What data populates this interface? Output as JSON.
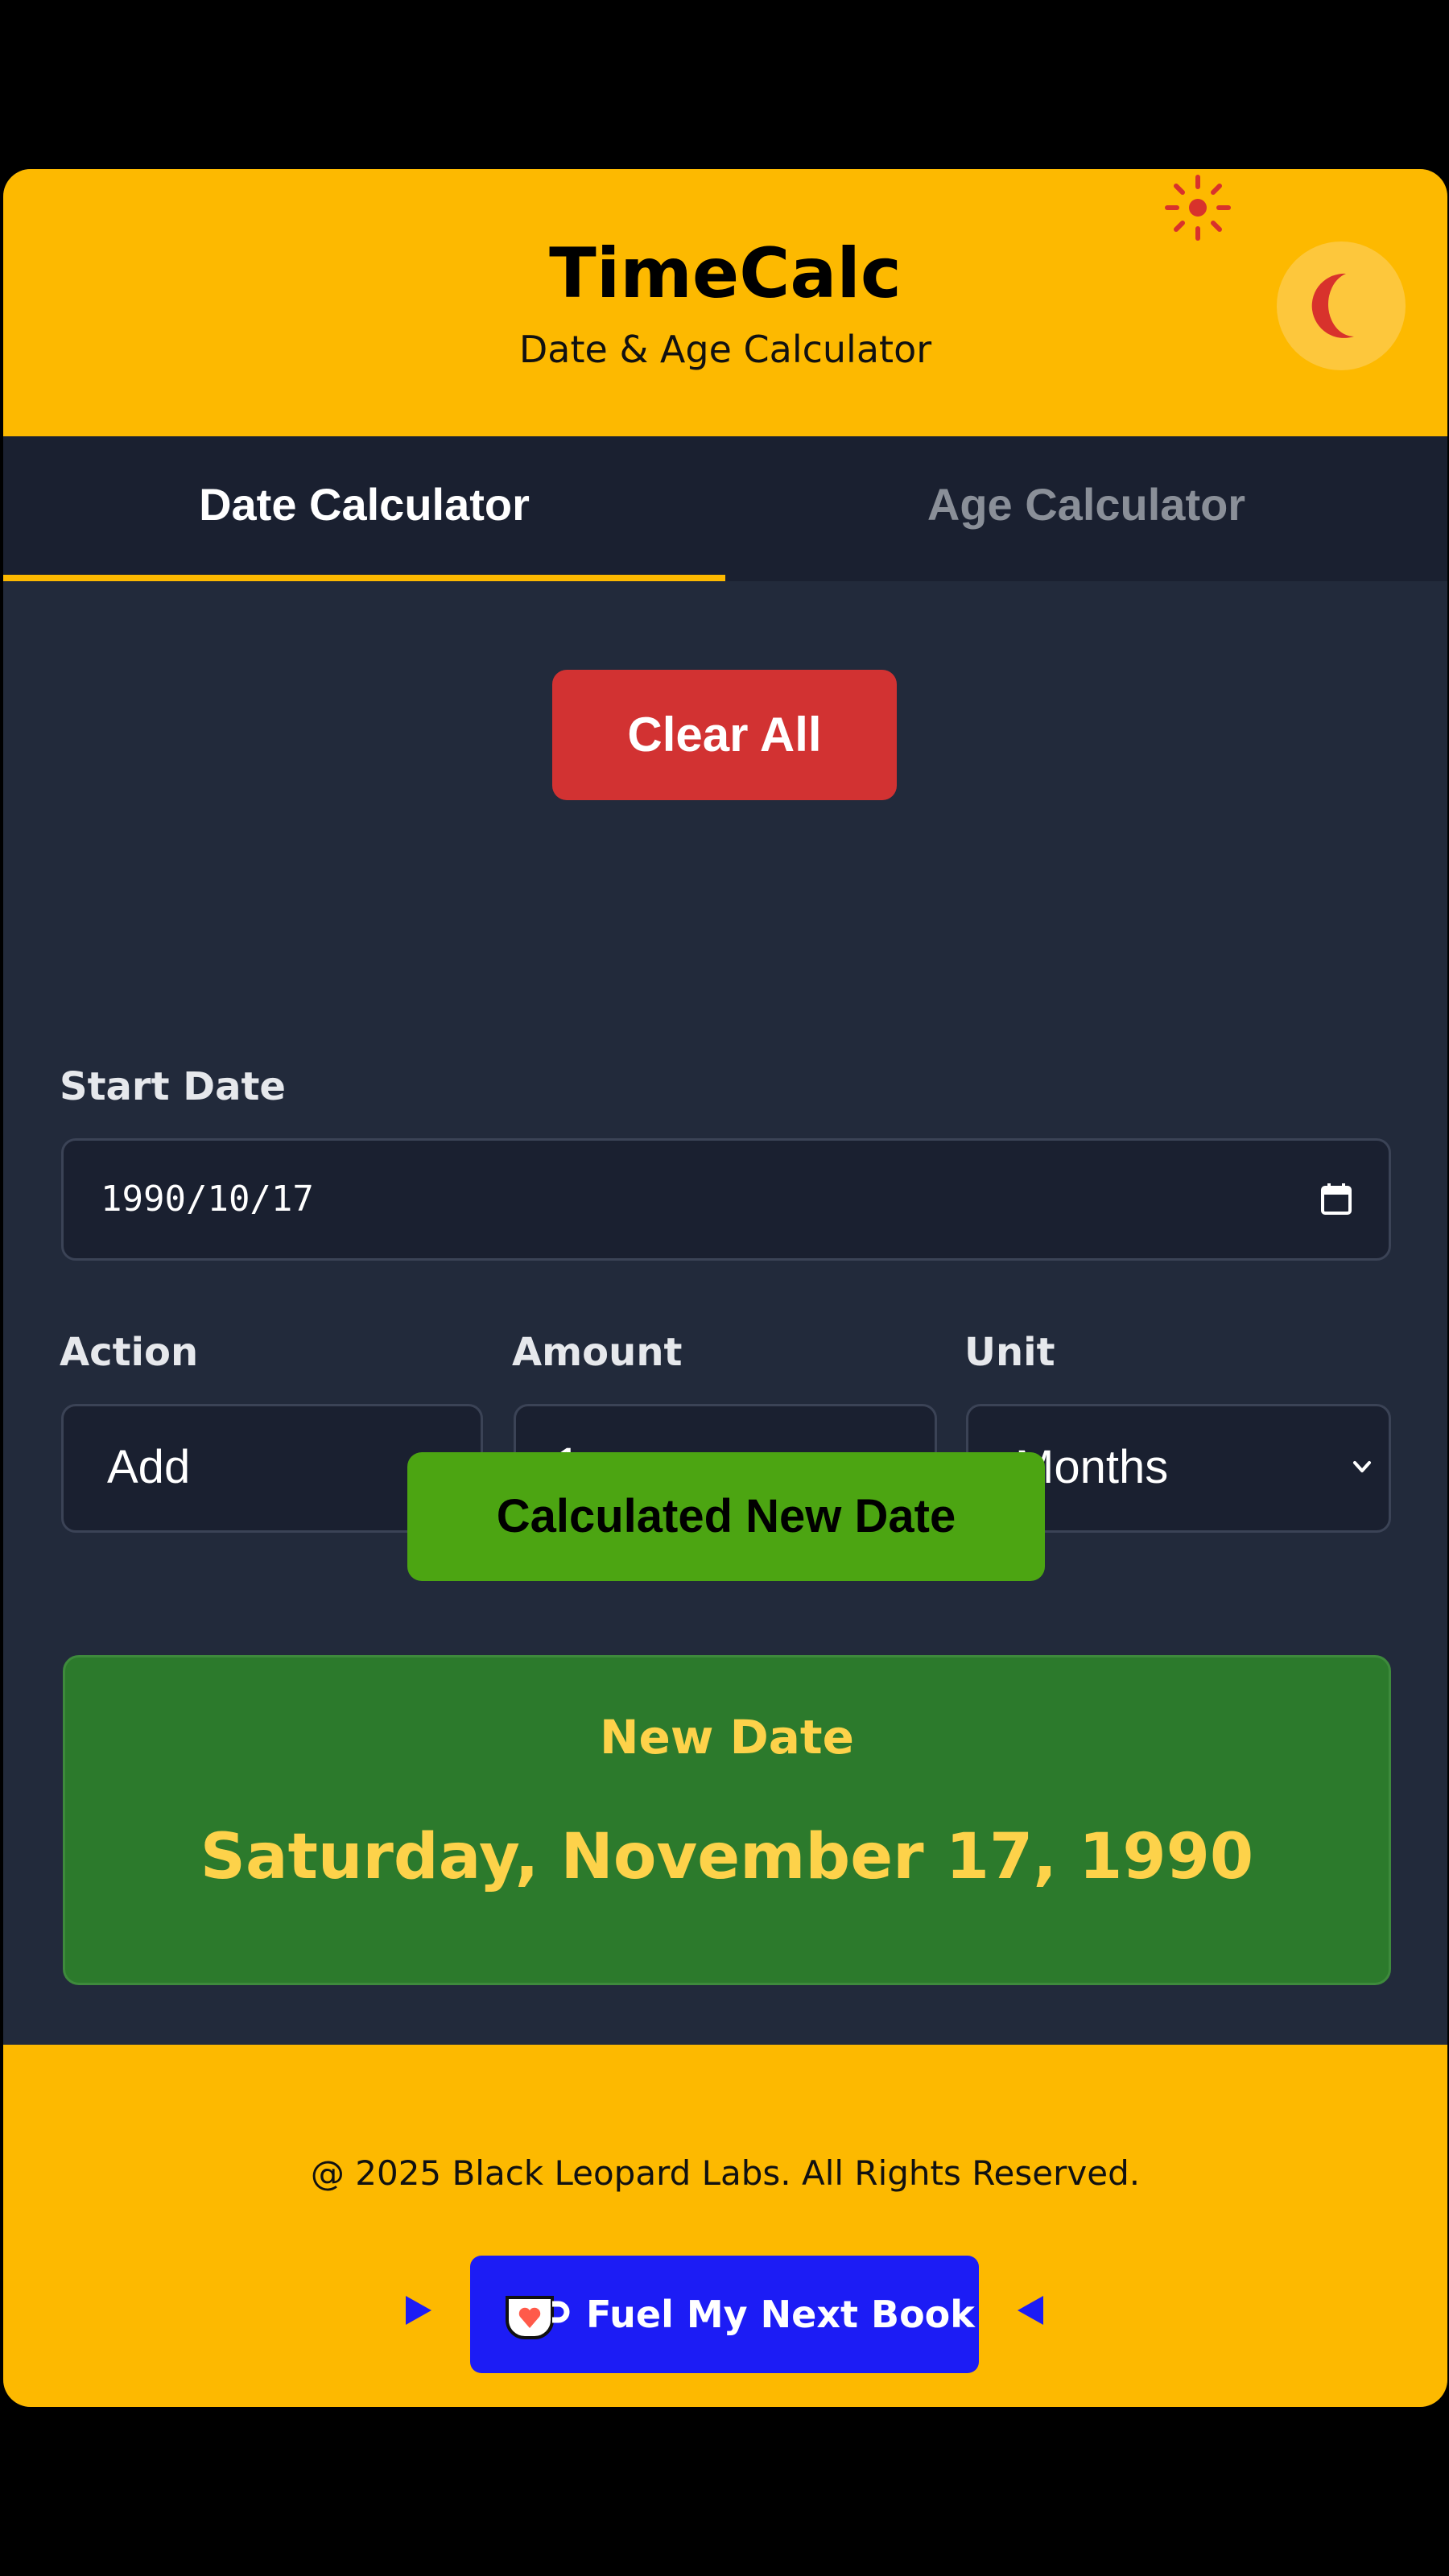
{
  "header": {
    "title": "TimeCalc",
    "subtitle": "Date & Age Calculator",
    "theme_light_icon": "sun-icon",
    "theme_dark_icon": "moon-icon"
  },
  "tabs": [
    {
      "label": "Date Calculator",
      "active": true
    },
    {
      "label": "Age Calculator",
      "active": false
    }
  ],
  "clear_button": "Clear All",
  "form": {
    "start_date_label": "Start Date",
    "start_date_value": "1990/10/17",
    "action_label": "Action",
    "action_value": "Add",
    "amount_label": "Amount",
    "amount_value": "1",
    "unit_label": "Unit",
    "unit_value": "Months"
  },
  "calculate_button": "Calculated New Date",
  "result": {
    "label": "New Date",
    "value": "Saturday, November 17, 1990"
  },
  "footer": {
    "copyright": "@ 2025 Black Leopard Labs. All Rights Reserved.",
    "support_button": "Fuel My Next Book",
    "support_icon": "coffee-cup-icon"
  },
  "colors": {
    "accent": "#fdb900",
    "danger": "#d23232",
    "success": "#4ca512",
    "result_bg": "#2c7a2c",
    "result_text": "#fdd24a",
    "support_bg": "#1c1cf5"
  }
}
